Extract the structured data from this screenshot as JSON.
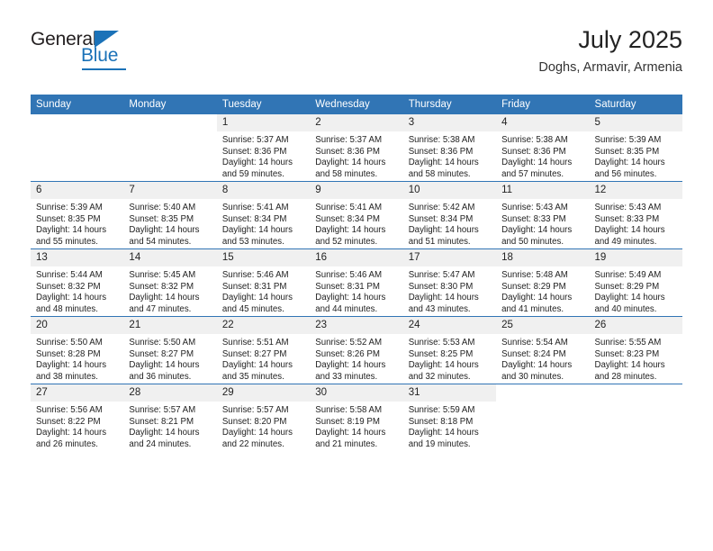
{
  "brand": {
    "name_top": "General",
    "name_bottom": "Blue",
    "accent_color": "#1b72b8",
    "triangle_icon": "triangle-icon"
  },
  "header": {
    "title": "July 2025",
    "subtitle": "Doghs, Armavir, Armenia"
  },
  "calendar": {
    "header_bg": "#3175b5",
    "daynum_bg": "#f0f0f0",
    "weekdays": [
      "Sunday",
      "Monday",
      "Tuesday",
      "Wednesday",
      "Thursday",
      "Friday",
      "Saturday"
    ],
    "weeks": [
      [
        {
          "day": "",
          "sunrise": "",
          "sunset": "",
          "daylight_1": "",
          "daylight_2": ""
        },
        {
          "day": "",
          "sunrise": "",
          "sunset": "",
          "daylight_1": "",
          "daylight_2": ""
        },
        {
          "day": "1",
          "sunrise": "Sunrise: 5:37 AM",
          "sunset": "Sunset: 8:36 PM",
          "daylight_1": "Daylight: 14 hours",
          "daylight_2": "and 59 minutes."
        },
        {
          "day": "2",
          "sunrise": "Sunrise: 5:37 AM",
          "sunset": "Sunset: 8:36 PM",
          "daylight_1": "Daylight: 14 hours",
          "daylight_2": "and 58 minutes."
        },
        {
          "day": "3",
          "sunrise": "Sunrise: 5:38 AM",
          "sunset": "Sunset: 8:36 PM",
          "daylight_1": "Daylight: 14 hours",
          "daylight_2": "and 58 minutes."
        },
        {
          "day": "4",
          "sunrise": "Sunrise: 5:38 AM",
          "sunset": "Sunset: 8:36 PM",
          "daylight_1": "Daylight: 14 hours",
          "daylight_2": "and 57 minutes."
        },
        {
          "day": "5",
          "sunrise": "Sunrise: 5:39 AM",
          "sunset": "Sunset: 8:35 PM",
          "daylight_1": "Daylight: 14 hours",
          "daylight_2": "and 56 minutes."
        }
      ],
      [
        {
          "day": "6",
          "sunrise": "Sunrise: 5:39 AM",
          "sunset": "Sunset: 8:35 PM",
          "daylight_1": "Daylight: 14 hours",
          "daylight_2": "and 55 minutes."
        },
        {
          "day": "7",
          "sunrise": "Sunrise: 5:40 AM",
          "sunset": "Sunset: 8:35 PM",
          "daylight_1": "Daylight: 14 hours",
          "daylight_2": "and 54 minutes."
        },
        {
          "day": "8",
          "sunrise": "Sunrise: 5:41 AM",
          "sunset": "Sunset: 8:34 PM",
          "daylight_1": "Daylight: 14 hours",
          "daylight_2": "and 53 minutes."
        },
        {
          "day": "9",
          "sunrise": "Sunrise: 5:41 AM",
          "sunset": "Sunset: 8:34 PM",
          "daylight_1": "Daylight: 14 hours",
          "daylight_2": "and 52 minutes."
        },
        {
          "day": "10",
          "sunrise": "Sunrise: 5:42 AM",
          "sunset": "Sunset: 8:34 PM",
          "daylight_1": "Daylight: 14 hours",
          "daylight_2": "and 51 minutes."
        },
        {
          "day": "11",
          "sunrise": "Sunrise: 5:43 AM",
          "sunset": "Sunset: 8:33 PM",
          "daylight_1": "Daylight: 14 hours",
          "daylight_2": "and 50 minutes."
        },
        {
          "day": "12",
          "sunrise": "Sunrise: 5:43 AM",
          "sunset": "Sunset: 8:33 PM",
          "daylight_1": "Daylight: 14 hours",
          "daylight_2": "and 49 minutes."
        }
      ],
      [
        {
          "day": "13",
          "sunrise": "Sunrise: 5:44 AM",
          "sunset": "Sunset: 8:32 PM",
          "daylight_1": "Daylight: 14 hours",
          "daylight_2": "and 48 minutes."
        },
        {
          "day": "14",
          "sunrise": "Sunrise: 5:45 AM",
          "sunset": "Sunset: 8:32 PM",
          "daylight_1": "Daylight: 14 hours",
          "daylight_2": "and 47 minutes."
        },
        {
          "day": "15",
          "sunrise": "Sunrise: 5:46 AM",
          "sunset": "Sunset: 8:31 PM",
          "daylight_1": "Daylight: 14 hours",
          "daylight_2": "and 45 minutes."
        },
        {
          "day": "16",
          "sunrise": "Sunrise: 5:46 AM",
          "sunset": "Sunset: 8:31 PM",
          "daylight_1": "Daylight: 14 hours",
          "daylight_2": "and 44 minutes."
        },
        {
          "day": "17",
          "sunrise": "Sunrise: 5:47 AM",
          "sunset": "Sunset: 8:30 PM",
          "daylight_1": "Daylight: 14 hours",
          "daylight_2": "and 43 minutes."
        },
        {
          "day": "18",
          "sunrise": "Sunrise: 5:48 AM",
          "sunset": "Sunset: 8:29 PM",
          "daylight_1": "Daylight: 14 hours",
          "daylight_2": "and 41 minutes."
        },
        {
          "day": "19",
          "sunrise": "Sunrise: 5:49 AM",
          "sunset": "Sunset: 8:29 PM",
          "daylight_1": "Daylight: 14 hours",
          "daylight_2": "and 40 minutes."
        }
      ],
      [
        {
          "day": "20",
          "sunrise": "Sunrise: 5:50 AM",
          "sunset": "Sunset: 8:28 PM",
          "daylight_1": "Daylight: 14 hours",
          "daylight_2": "and 38 minutes."
        },
        {
          "day": "21",
          "sunrise": "Sunrise: 5:50 AM",
          "sunset": "Sunset: 8:27 PM",
          "daylight_1": "Daylight: 14 hours",
          "daylight_2": "and 36 minutes."
        },
        {
          "day": "22",
          "sunrise": "Sunrise: 5:51 AM",
          "sunset": "Sunset: 8:27 PM",
          "daylight_1": "Daylight: 14 hours",
          "daylight_2": "and 35 minutes."
        },
        {
          "day": "23",
          "sunrise": "Sunrise: 5:52 AM",
          "sunset": "Sunset: 8:26 PM",
          "daylight_1": "Daylight: 14 hours",
          "daylight_2": "and 33 minutes."
        },
        {
          "day": "24",
          "sunrise": "Sunrise: 5:53 AM",
          "sunset": "Sunset: 8:25 PM",
          "daylight_1": "Daylight: 14 hours",
          "daylight_2": "and 32 minutes."
        },
        {
          "day": "25",
          "sunrise": "Sunrise: 5:54 AM",
          "sunset": "Sunset: 8:24 PM",
          "daylight_1": "Daylight: 14 hours",
          "daylight_2": "and 30 minutes."
        },
        {
          "day": "26",
          "sunrise": "Sunrise: 5:55 AM",
          "sunset": "Sunset: 8:23 PM",
          "daylight_1": "Daylight: 14 hours",
          "daylight_2": "and 28 minutes."
        }
      ],
      [
        {
          "day": "27",
          "sunrise": "Sunrise: 5:56 AM",
          "sunset": "Sunset: 8:22 PM",
          "daylight_1": "Daylight: 14 hours",
          "daylight_2": "and 26 minutes."
        },
        {
          "day": "28",
          "sunrise": "Sunrise: 5:57 AM",
          "sunset": "Sunset: 8:21 PM",
          "daylight_1": "Daylight: 14 hours",
          "daylight_2": "and 24 minutes."
        },
        {
          "day": "29",
          "sunrise": "Sunrise: 5:57 AM",
          "sunset": "Sunset: 8:20 PM",
          "daylight_1": "Daylight: 14 hours",
          "daylight_2": "and 22 minutes."
        },
        {
          "day": "30",
          "sunrise": "Sunrise: 5:58 AM",
          "sunset": "Sunset: 8:19 PM",
          "daylight_1": "Daylight: 14 hours",
          "daylight_2": "and 21 minutes."
        },
        {
          "day": "31",
          "sunrise": "Sunrise: 5:59 AM",
          "sunset": "Sunset: 8:18 PM",
          "daylight_1": "Daylight: 14 hours",
          "daylight_2": "and 19 minutes."
        },
        {
          "day": "",
          "sunrise": "",
          "sunset": "",
          "daylight_1": "",
          "daylight_2": ""
        },
        {
          "day": "",
          "sunrise": "",
          "sunset": "",
          "daylight_1": "",
          "daylight_2": ""
        }
      ]
    ]
  }
}
